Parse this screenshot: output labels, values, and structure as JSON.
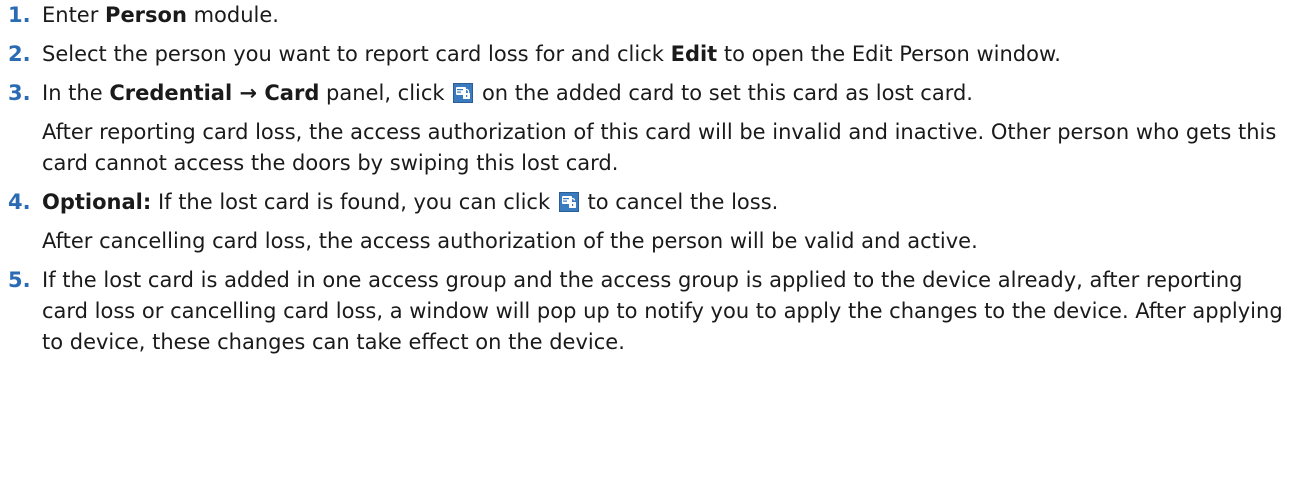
{
  "steps": [
    {
      "number": "1.",
      "before": "Enter ",
      "bold": "Person",
      "after": " module."
    },
    {
      "number": "2.",
      "before": "Select the person you want to report card loss for and click ",
      "bold": "Edit",
      "after": " to open the Edit Person window."
    },
    {
      "number": "3.",
      "before": "In the ",
      "bold1": "Credential",
      "arrow": " → ",
      "bold2": "Card",
      "middle": " panel, click ",
      "icon": "report-card-loss-icon",
      "after": " on the added card to set this card as lost card.",
      "note": "After reporting card loss, the access authorization of this card will be invalid and inactive. Other person who gets this card cannot access the doors by swiping this lost card."
    },
    {
      "number": "4.",
      "bold": "Optional:",
      "before": " If the lost card is found, you can click ",
      "icon": "cancel-card-loss-icon",
      "after": " to cancel the loss.",
      "note": "After cancelling card loss, the access authorization of the person will be valid and active."
    },
    {
      "number": "5.",
      "text": "If the lost card is added in one access group and the access group is applied to the device already, after reporting card loss or cancelling card loss, a window will pop up to notify you to apply the changes to the device. After applying to device, these changes can take effect on the device."
    }
  ]
}
